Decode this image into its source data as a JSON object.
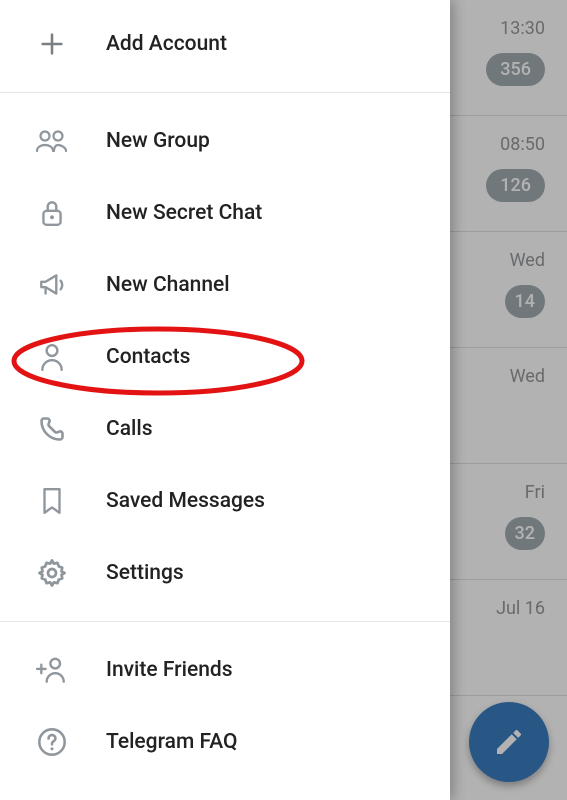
{
  "drawer": {
    "add_account": "Add Account",
    "new_group": "New Group",
    "new_secret_chat": "New Secret Chat",
    "new_channel": "New Channel",
    "contacts": "Contacts",
    "calls": "Calls",
    "saved_messages": "Saved Messages",
    "settings": "Settings",
    "invite_friends": "Invite Friends",
    "telegram_faq": "Telegram FAQ"
  },
  "chats": [
    {
      "time": "13:30",
      "badge": "356"
    },
    {
      "time": "08:50",
      "badge": "126"
    },
    {
      "time": "Wed",
      "badge": "14"
    },
    {
      "time": "Wed",
      "badge": ""
    },
    {
      "time": "Fri",
      "badge": "32"
    },
    {
      "time": "Jul 16",
      "badge": ""
    }
  ],
  "highlight": {
    "target": "contacts"
  }
}
